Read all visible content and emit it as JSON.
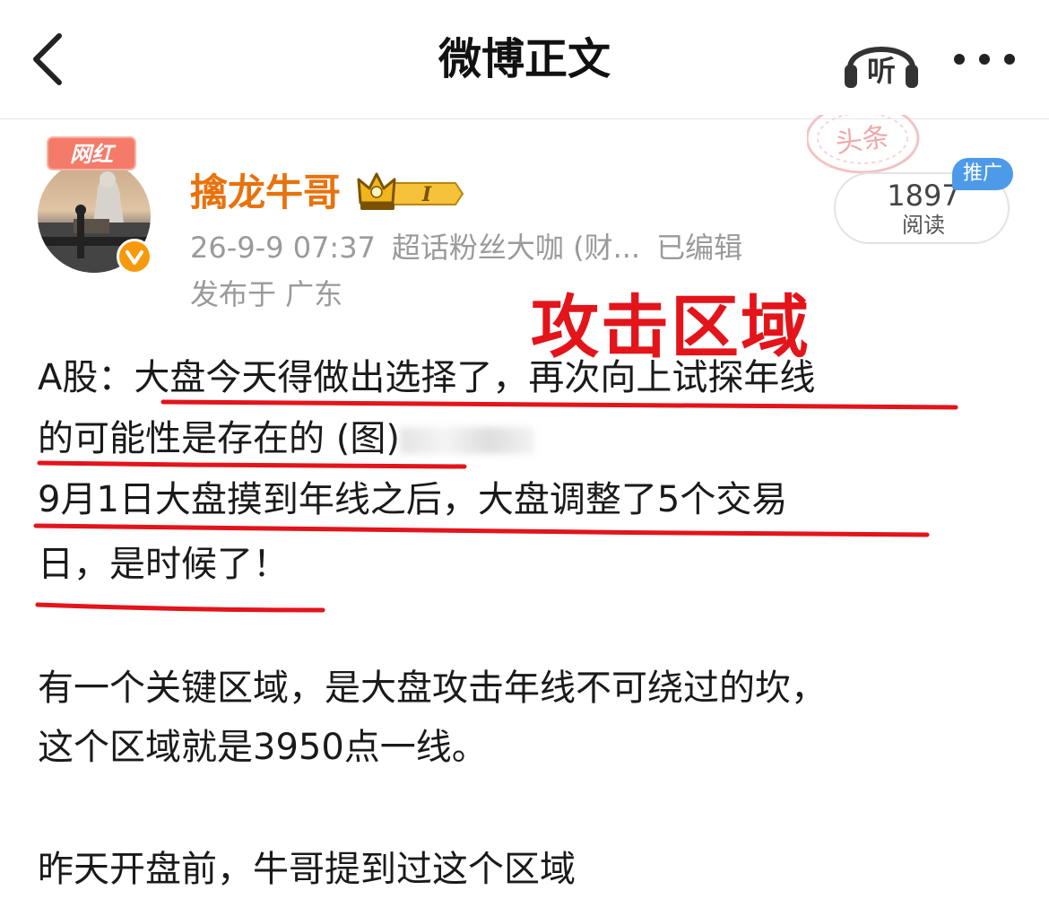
{
  "nav": {
    "title": "微博正文",
    "listen_label": "听"
  },
  "stamp": {
    "text": "头条"
  },
  "author": {
    "badge": "网红",
    "name": "擒龙牛哥",
    "level": "I",
    "date": "26-9-9 07:37",
    "source": "超话粉丝大咖 (财...",
    "edited": "已编辑",
    "location": "发布于 广东"
  },
  "read": {
    "count": "1897",
    "label": "阅读",
    "promo": "推广"
  },
  "annotation": "攻击区域",
  "post": {
    "line1": "A股：大盘今天得做出选择了，再次向上试探年线",
    "line2": "的可能性是存在的 (图)",
    "line3": "9月1日大盘摸到年线之后，大盘调整了5个交易",
    "line4": "日，是时候了！",
    "line5": "有一个关键区域，是大盘攻击年线不可绕过的坎，",
    "line6": "这个区域就是3950点一线。",
    "line7": "昨天开盘前，牛哥提到过这个区域"
  },
  "colors": {
    "accent_orange": "#e8720c",
    "annotation_red": "#e3141a",
    "promo_blue": "#4d9ae8",
    "meta_gray": "#9a9a9a"
  }
}
